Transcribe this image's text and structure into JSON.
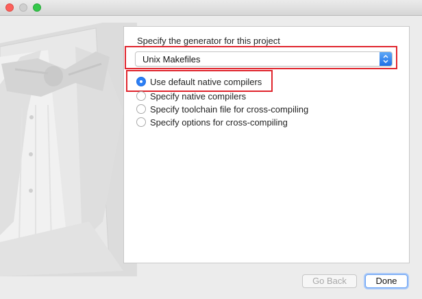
{
  "window": {
    "traffic_lights": [
      "close",
      "minimize",
      "zoom"
    ]
  },
  "artwork": "tuxedo-illustration",
  "panel": {
    "prompt": "Specify the generator for this project",
    "generator_select": {
      "value": "Unix Makefiles"
    },
    "options": [
      {
        "label": "Use default native compilers",
        "selected": true
      },
      {
        "label": "Specify native compilers",
        "selected": false
      },
      {
        "label": "Specify toolchain file for cross-compiling",
        "selected": false
      },
      {
        "label": "Specify options for cross-compiling",
        "selected": false
      }
    ]
  },
  "buttons": {
    "back": "Go Back",
    "done": "Done"
  },
  "colors": {
    "highlight": "#e0242c",
    "accent": "#2b7ff5"
  }
}
